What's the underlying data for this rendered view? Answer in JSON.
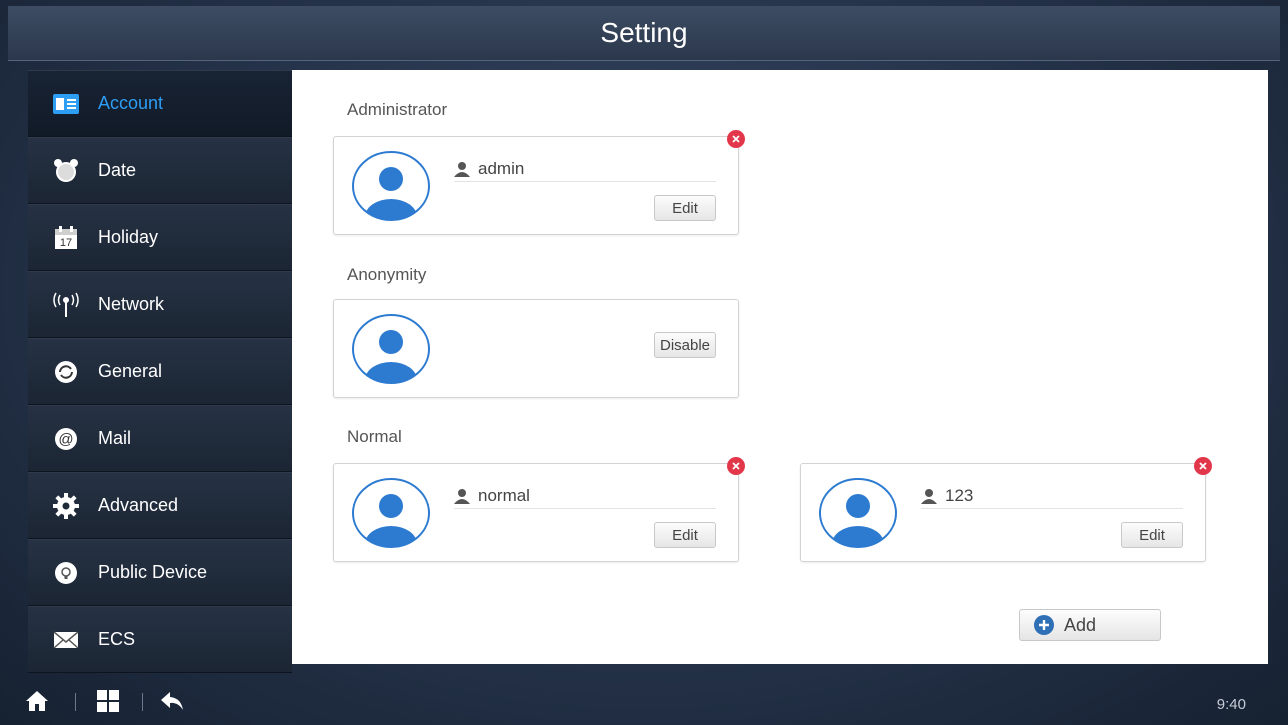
{
  "title": "Setting",
  "sidebar": {
    "items": [
      {
        "label": "Account",
        "icon": "account-card-icon",
        "active": true
      },
      {
        "label": "Date",
        "icon": "alarm-clock-icon"
      },
      {
        "label": "Holiday",
        "icon": "calendar-icon"
      },
      {
        "label": "Network",
        "icon": "wireless-antenna-icon"
      },
      {
        "label": "General",
        "icon": "refresh-icon"
      },
      {
        "label": "Mail",
        "icon": "at-sign-icon"
      },
      {
        "label": "Advanced",
        "icon": "gear-icon"
      },
      {
        "label": "Public Device",
        "icon": "lightbulb-icon"
      },
      {
        "label": "ECS",
        "icon": "envelope-icon"
      }
    ]
  },
  "main": {
    "administrator": {
      "label": "Administrator",
      "user": "admin",
      "edit_label": "Edit"
    },
    "anonymity": {
      "label": "Anonymity",
      "disable_label": "Disable"
    },
    "normal": {
      "label": "Normal",
      "users": [
        {
          "name": "normal",
          "edit_label": "Edit"
        },
        {
          "name": "123",
          "edit_label": "Edit"
        }
      ]
    },
    "add_label": "Add"
  },
  "status": {
    "time": "9:40"
  },
  "colors": {
    "accent": "#2e9df4",
    "delete": "#e2374b",
    "avatar": "#2d7bd0"
  }
}
